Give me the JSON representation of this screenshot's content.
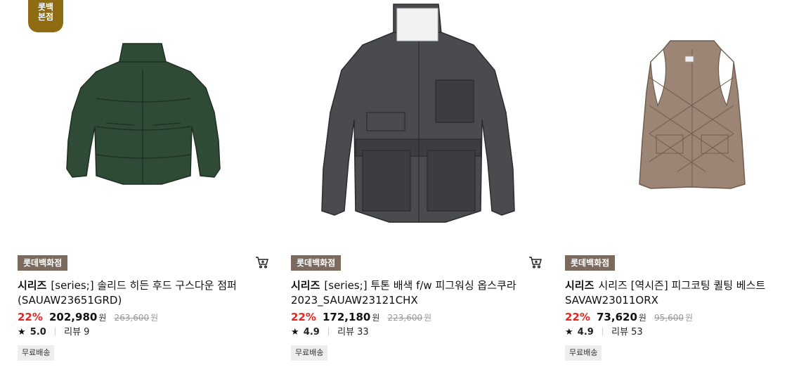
{
  "products": [
    {
      "store_badge": "롯백\n본점",
      "mall": "롯데백화점",
      "brand": "시리즈",
      "name": "[series;] 솔리드 히든 후드 구스다운 점퍼 (SAUAW23651GRD)",
      "discount": "22%",
      "price": "202,980",
      "currency": "원",
      "original_price": "263,600",
      "rating": "5.0",
      "review_label": "리뷰 9",
      "shipping": "무료배송",
      "image_color": "#2f4a35"
    },
    {
      "mall": "롯데백화점",
      "brand": "시리즈",
      "name": "[series;] 투톤 배색 f/w 피그워싱 옵스쿠라 2023_SAUAW23121CHX",
      "discount": "22%",
      "price": "172,180",
      "currency": "원",
      "original_price": "223,600",
      "rating": "4.9",
      "review_label": "리뷰 33",
      "shipping": "무료배송",
      "image_color": "#4a4b4e"
    },
    {
      "mall": "롯데백화점",
      "brand": "시리즈",
      "name": "시리즈 [역시즌] 피그코팅 퀼팅 베스트 SAVAW23011ORX",
      "discount": "22%",
      "price": "73,620",
      "currency": "원",
      "original_price": "95,600",
      "rating": "4.9",
      "review_label": "리뷰 53",
      "shipping": "무료배송",
      "image_color": "#9c8574"
    }
  ]
}
